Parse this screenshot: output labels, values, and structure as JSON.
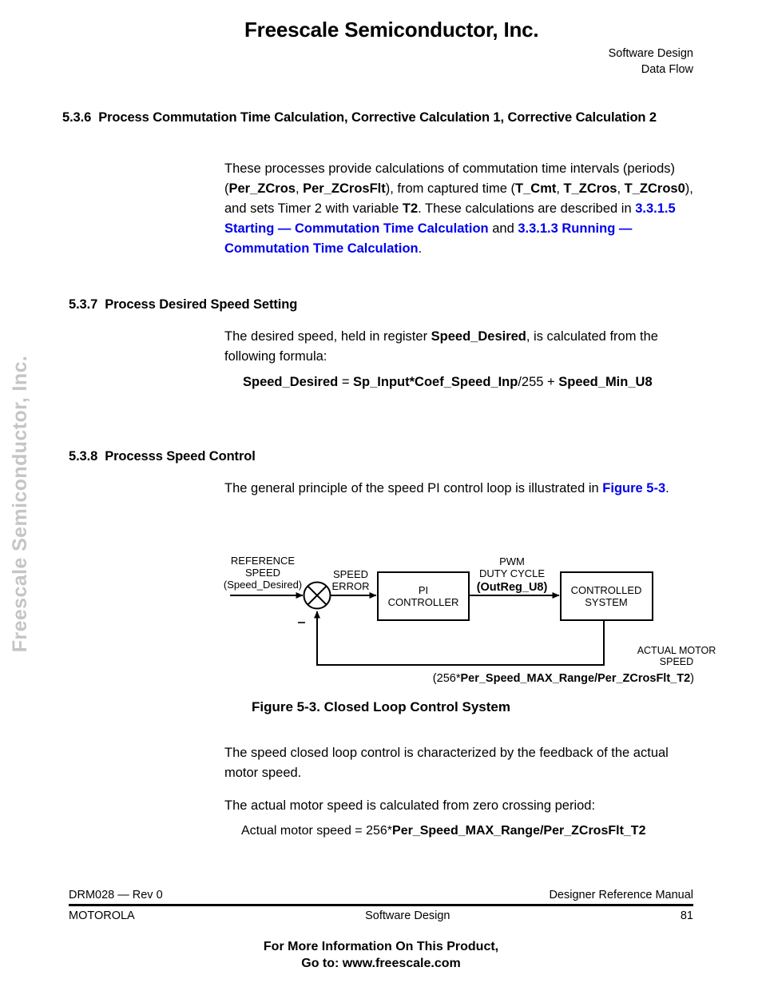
{
  "watermark": {
    "text": "Freescale Semiconductor, Inc."
  },
  "header": {
    "brand": "Freescale Semiconductor, Inc.",
    "right_line1": "Software Design",
    "right_line2": "Data Flow"
  },
  "sections": {
    "s536": {
      "number": "5.3.6",
      "title": "Process Commutation Time Calculation, Corrective Calculation 1, Corrective Calculation 2",
      "para_1a": "These processes provide calculations of commutation time intervals (periods) (",
      "var_per_zcros": "Per_ZCros",
      "sep_comma": ", ",
      "var_per_zcrosflt": "Per_ZCrosFlt",
      "para_1b": "), from captured time (",
      "var_t_cmt": "T_Cmt",
      "para_1c": ", ",
      "var_t_zcros": "T_ZCros",
      "para_1d": ", ",
      "var_t_zcros0": "T_ZCros0",
      "para_1e": "), and sets Timer 2 with variable ",
      "var_t2": "T2",
      "para_1f": ". These calculations are described in ",
      "xref_1": "3.3.1.5 Starting — Commutation Time Calculation",
      "para_1g": " and ",
      "xref_2": "3.3.1.3 Running — Commutation Time Calculation",
      "para_1h": "."
    },
    "s537": {
      "number": "5.3.7",
      "title": "Process Desired Speed Setting",
      "para_1a": "The desired speed, held in register ",
      "var_speed_desired": "Speed_Desired",
      "para_1b": ", is calculated from the following formula:",
      "formula_lhs": "Speed_Desired",
      "formula_eq": " = ",
      "formula_rhs1": "Sp_Input*Coef_Speed_Inp",
      "formula_rhs2": "/255 + ",
      "formula_rhs3": "Speed_Min_U8"
    },
    "s538": {
      "number": "5.3.8",
      "title": "Processs Speed Control",
      "para_1a": "The general principle of the speed PI control loop is illustrated in ",
      "xref_figure": "Figure 5-3",
      "para_1b": ".",
      "para_2": "The speed closed loop control is characterized by the feedback of the actual motor speed.",
      "para_3": "The actual motor speed is calculated from zero crossing period:",
      "eq_prefix": "Actual motor speed = 256*",
      "eq_bold": "Per_Speed_MAX_Range/Per_ZCrosFlt_T2"
    }
  },
  "figure": {
    "caption": "Figure 5-3. Closed Loop Control System",
    "formula_open": "(256*",
    "formula_bold": "Per_Speed_MAX_Range/Per_ZCrosFlt_T2",
    "formula_close": ")",
    "labels": {
      "reference_speed_l1": "REFERENCE",
      "reference_speed_l2": "SPEED",
      "reference_speed_l3": "(Speed_Desired)",
      "speed_error_l1": "SPEED",
      "speed_error_l2": "ERROR",
      "pi_controller_l1": "PI",
      "pi_controller_l2": "CONTROLLER",
      "pwm_l1": "PWM",
      "pwm_l2": "DUTY CYCLE",
      "pwm_l3": "(OutReg_U8)",
      "controlled_system_l1": "CONTROLLED",
      "controlled_system_l2": "SYSTEM",
      "actual_motor_l1": "ACTUAL MOTOR",
      "actual_motor_l2": "SPEED",
      "minus_sign": "_"
    }
  },
  "footer": {
    "doc_id": "DRM028 — Rev 0",
    "manual": "Designer Reference Manual",
    "company": "MOTOROLA",
    "center": "Software Design",
    "page": "81",
    "promo_l1": "For More Information On This Product,",
    "promo_l2": "Go to: www.freescale.com"
  },
  "colors": {
    "link": "#0000ee",
    "watermark": "#c5c5c5",
    "text": "#000000"
  }
}
